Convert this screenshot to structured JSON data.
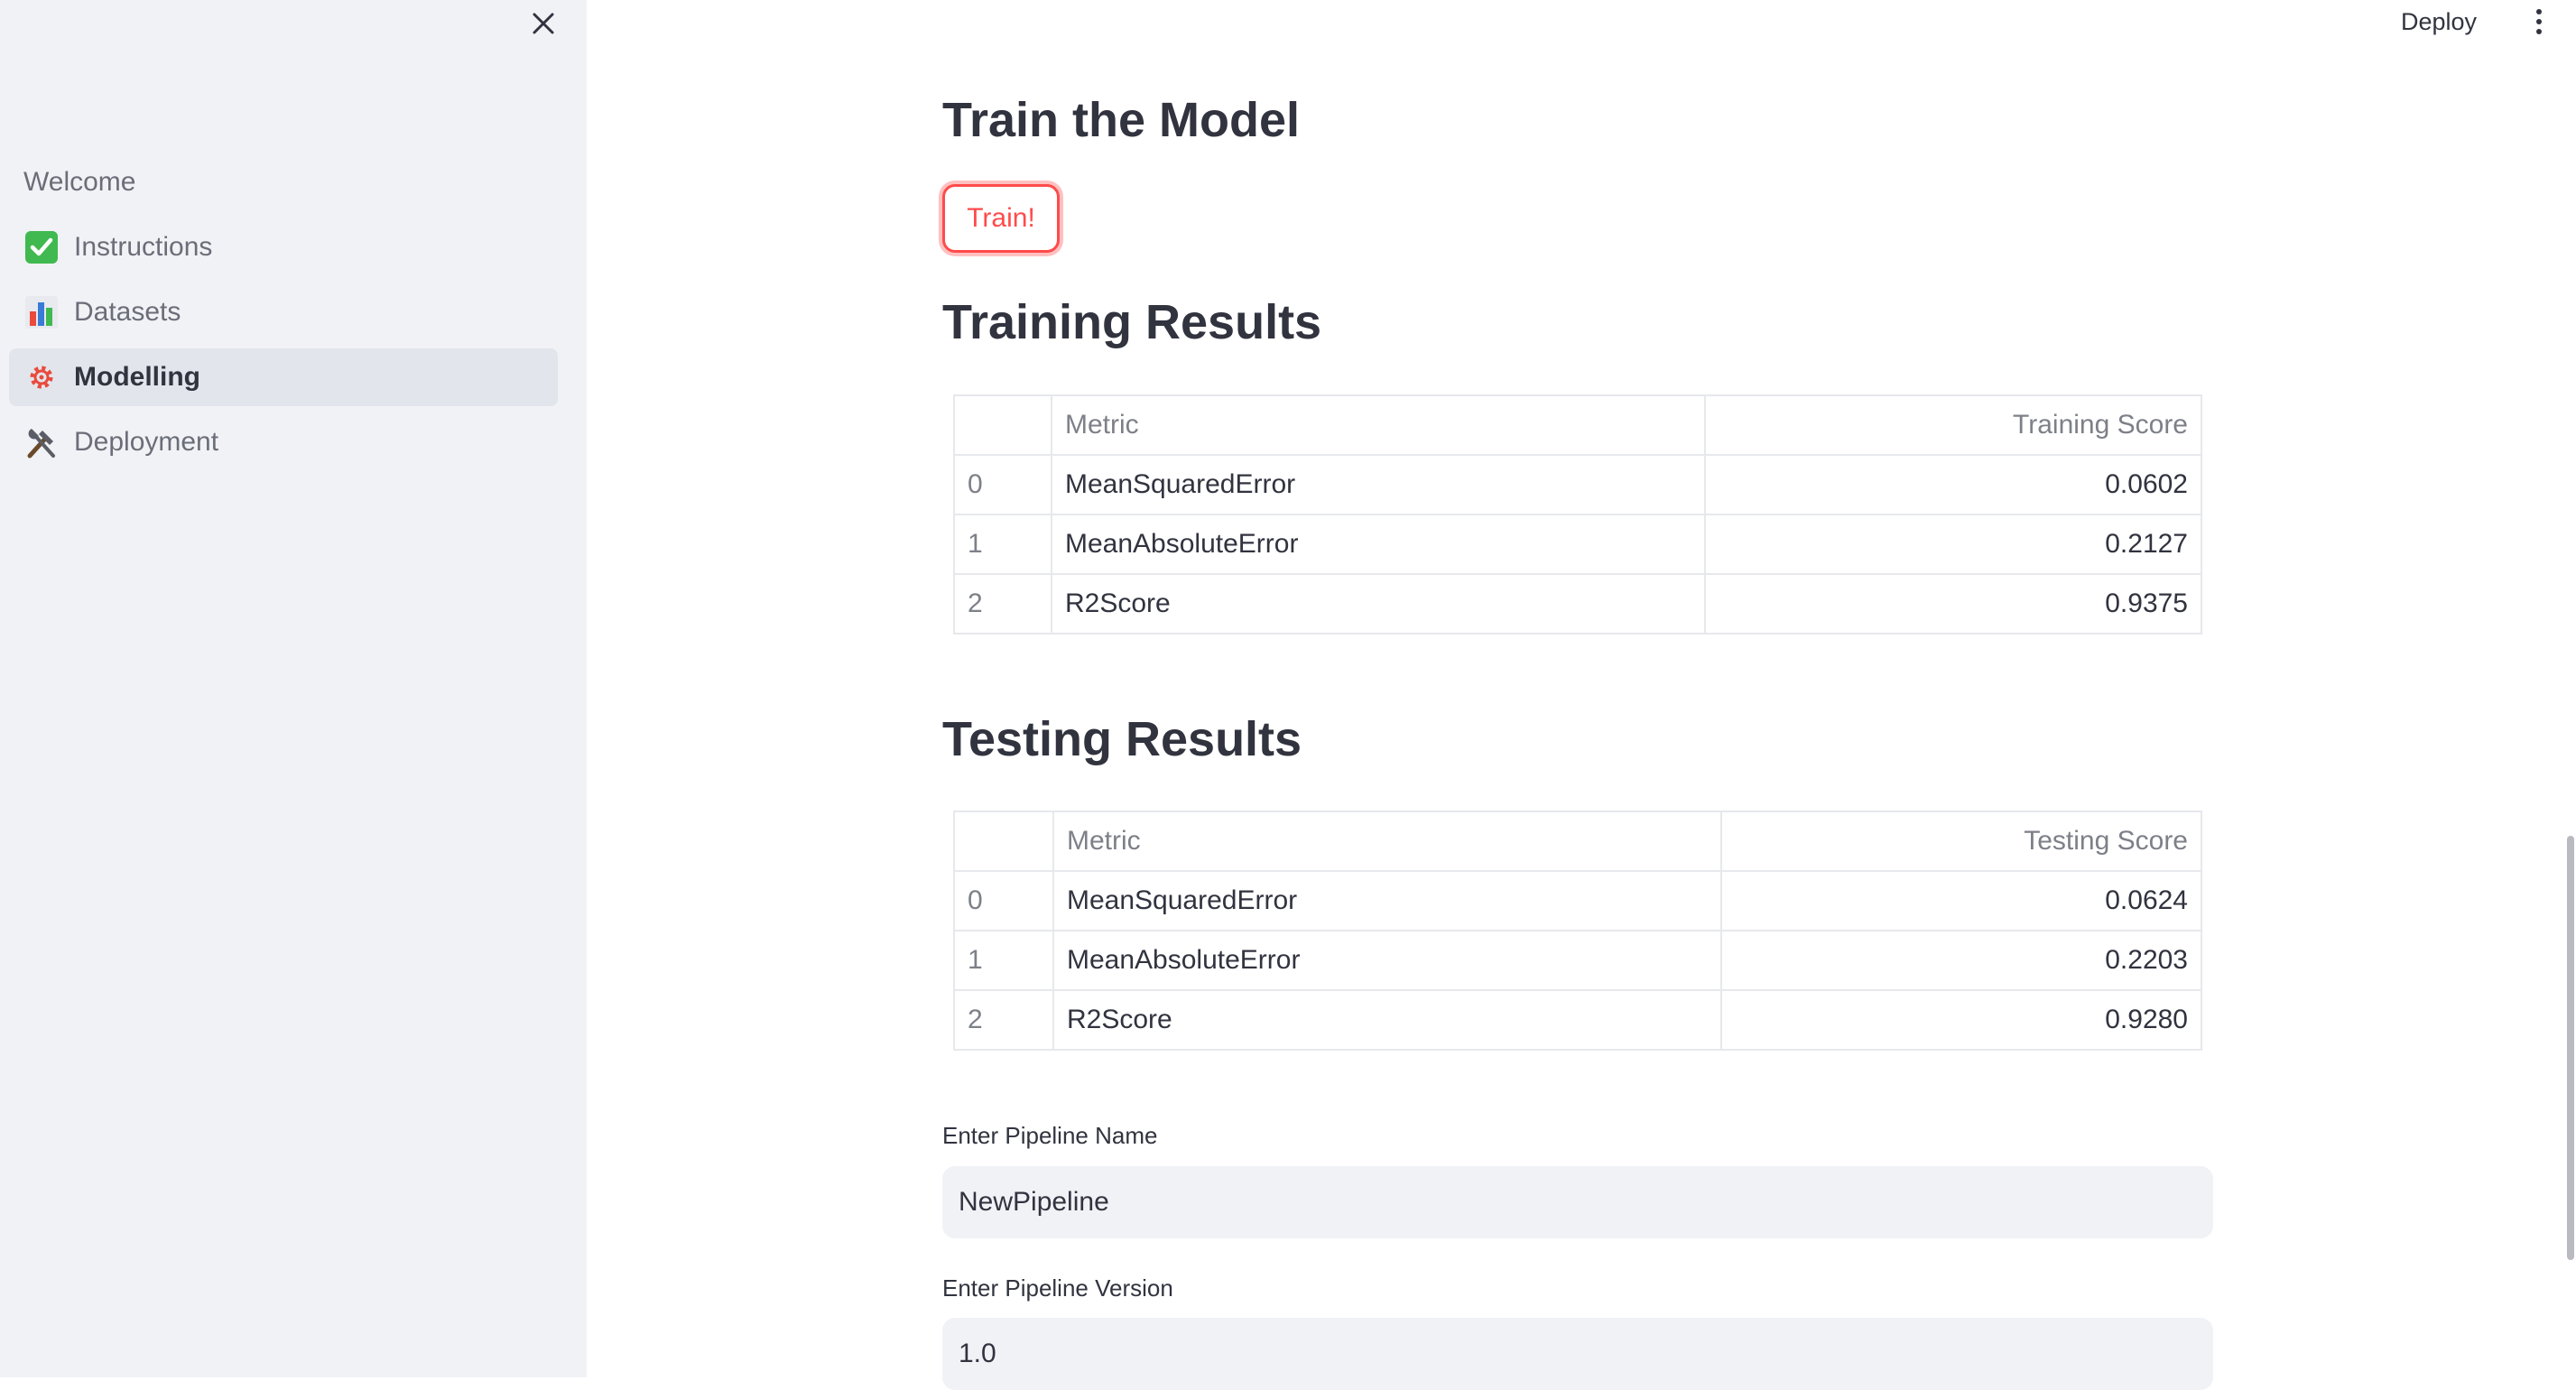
{
  "sidebar": {
    "items": [
      {
        "label": "Welcome",
        "icon": ""
      },
      {
        "label": "Instructions",
        "icon": "check-mark-icon"
      },
      {
        "label": "Datasets",
        "icon": "bar-chart-icon"
      },
      {
        "label": "Modelling",
        "icon": "gear-icon",
        "active": true
      },
      {
        "label": "Deployment",
        "icon": "tools-icon"
      }
    ]
  },
  "header": {
    "deploy_label": "Deploy"
  },
  "main": {
    "train_title": "Train the Model",
    "train_button": "Train!",
    "training_results_title": "Training Results",
    "training_table": {
      "columns": [
        "",
        "Metric",
        "Training Score"
      ],
      "rows": [
        [
          "0",
          "MeanSquaredError",
          "0.0602"
        ],
        [
          "1",
          "MeanAbsoluteError",
          "0.2127"
        ],
        [
          "2",
          "R2Score",
          "0.9375"
        ]
      ]
    },
    "testing_results_title": "Testing Results",
    "testing_table": {
      "columns": [
        "",
        "Metric",
        "Testing Score"
      ],
      "rows": [
        [
          "0",
          "MeanSquaredError",
          "0.0624"
        ],
        [
          "1",
          "MeanAbsoluteError",
          "0.2203"
        ],
        [
          "2",
          "R2Score",
          "0.9280"
        ]
      ]
    },
    "pipeline_name_label": "Enter Pipeline Name",
    "pipeline_name_value": "NewPipeline",
    "pipeline_version_label": "Enter Pipeline Version",
    "pipeline_version_value": "1.0"
  },
  "colors": {
    "accent": "#ff4b4b",
    "sidebar_bg": "#f0f2f6",
    "text": "#31333f"
  }
}
